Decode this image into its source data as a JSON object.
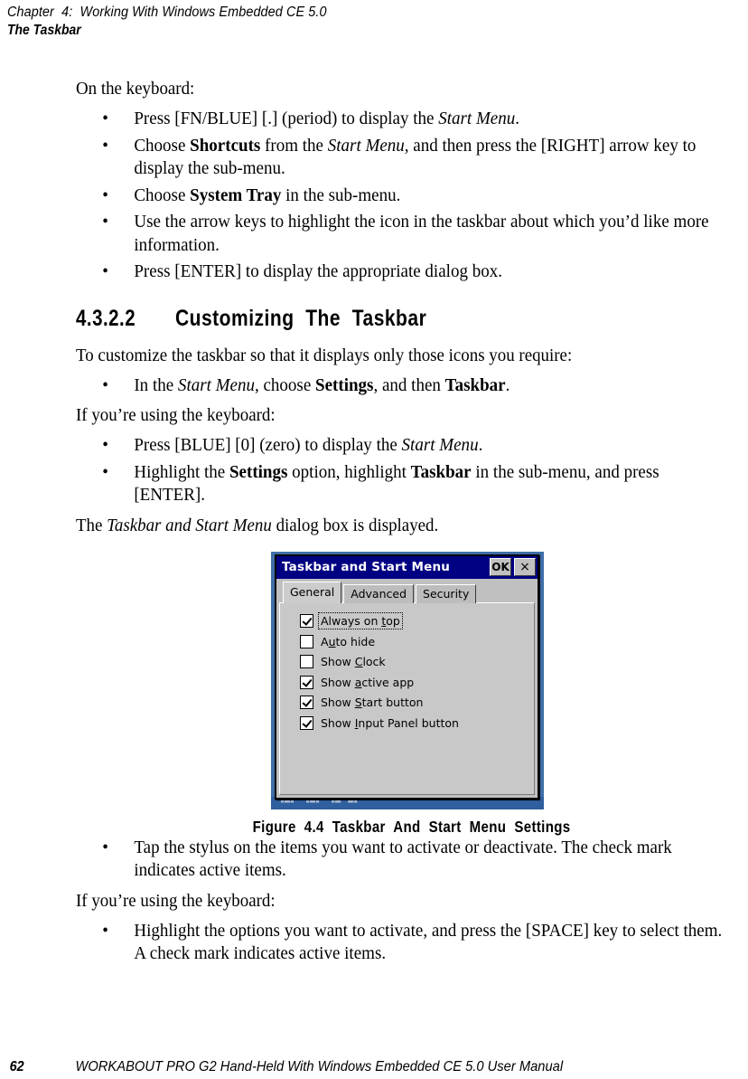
{
  "running_head": {
    "chapter": "Chapter  4:  Working With Windows Embedded CE 5.0",
    "section": "The Taskbar"
  },
  "content": {
    "intro_keyboard": "On the keyboard:",
    "bullets_1": [
      {
        "parts": [
          {
            "text": "Press [FN/BLUE] [.] (period) to display the ",
            "style": "normal"
          },
          {
            "text": "Start Menu",
            "style": "italic"
          },
          {
            "text": ".",
            "style": "normal"
          }
        ]
      },
      {
        "parts": [
          {
            "text": "Choose ",
            "style": "normal"
          },
          {
            "text": "Shortcuts",
            "style": "bold"
          },
          {
            "text": " from the ",
            "style": "normal"
          },
          {
            "text": "Start Menu",
            "style": "italic"
          },
          {
            "text": ", and then press the [RIGHT] arrow key to display the sub-menu.",
            "style": "normal"
          }
        ]
      },
      {
        "parts": [
          {
            "text": "Choose ",
            "style": "normal"
          },
          {
            "text": "System Tray",
            "style": "bold"
          },
          {
            "text": " in the sub-menu.",
            "style": "normal"
          }
        ]
      },
      {
        "parts": [
          {
            "text": "Use the arrow keys to highlight the icon in the taskbar about which you’d like more information.",
            "style": "normal"
          }
        ]
      },
      {
        "parts": [
          {
            "text": "Press [ENTER] to display the appropriate dialog box.",
            "style": "normal"
          }
        ]
      }
    ],
    "heading": {
      "number": "4.3.2.2",
      "title": "Customizing  The  Taskbar"
    },
    "para_customize": "To customize the taskbar so that it displays only those icons you require:",
    "bullets_2": [
      {
        "parts": [
          {
            "text": "In the ",
            "style": "normal"
          },
          {
            "text": "Start Menu",
            "style": "italic"
          },
          {
            "text": ", choose ",
            "style": "normal"
          },
          {
            "text": "Settings",
            "style": "bold"
          },
          {
            "text": ", and then ",
            "style": "normal"
          },
          {
            "text": "Taskbar",
            "style": "bold"
          },
          {
            "text": ".",
            "style": "normal"
          }
        ]
      }
    ],
    "para_keyboard_1": "If you’re using the keyboard:",
    "bullets_3": [
      {
        "parts": [
          {
            "text": "Press [BLUE] [0] (zero) to display the ",
            "style": "normal"
          },
          {
            "text": "Start Menu",
            "style": "italic"
          },
          {
            "text": ".",
            "style": "normal"
          }
        ]
      },
      {
        "parts": [
          {
            "text": "Highlight the ",
            "style": "normal"
          },
          {
            "text": "Settings",
            "style": "bold"
          },
          {
            "text": " option, highlight ",
            "style": "normal"
          },
          {
            "text": "Taskbar",
            "style": "bold"
          },
          {
            "text": " in the sub-menu, and press [ENTER].",
            "style": "normal"
          }
        ]
      }
    ],
    "para_dialog_displayed": {
      "parts": [
        {
          "text": "The ",
          "style": "normal"
        },
        {
          "text": "Taskbar and Start Menu",
          "style": "italic"
        },
        {
          "text": " dialog box is displayed.",
          "style": "normal"
        }
      ]
    },
    "bullets_4": [
      {
        "parts": [
          {
            "text": "Tap the stylus on the items you want to activate or deactivate. The check mark indicates active items.",
            "style": "normal"
          }
        ]
      }
    ],
    "para_keyboard_2": "If you’re using the keyboard:",
    "bullets_5": [
      {
        "parts": [
          {
            "text": "Highlight the options you want to activate, and press the [SPACE] key to select them. A check mark indicates active items.",
            "style": "normal"
          }
        ]
      }
    ],
    "figure_caption": "Figure  4.4  Taskbar  And  Start  Menu  Settings"
  },
  "dialog": {
    "title": "Taskbar and Start Menu",
    "ok_label": "OK",
    "close_label": "×",
    "tabs": [
      {
        "label": "General",
        "active": true
      },
      {
        "label": "Advanced",
        "active": false
      },
      {
        "label": "Security",
        "active": false
      }
    ],
    "options": [
      {
        "pre": "Always on ",
        "accel": "t",
        "post": "op",
        "checked": true,
        "focused": true
      },
      {
        "pre": "A",
        "accel": "u",
        "post": "to hide",
        "checked": false,
        "focused": false
      },
      {
        "pre": "Show ",
        "accel": "C",
        "post": "lock",
        "checked": false,
        "focused": false
      },
      {
        "pre": "Show ",
        "accel": "a",
        "post": "ctive app",
        "checked": true,
        "focused": false
      },
      {
        "pre": "Show ",
        "accel": "S",
        "post": "tart button",
        "checked": true,
        "focused": false
      },
      {
        "pre": "Show ",
        "accel": "I",
        "post": "nput Panel button",
        "checked": true,
        "focused": false
      }
    ],
    "taskbar_glyphs": "▐█▌ ▐█▌ ▐█─█▌",
    "colors": {
      "titlebar": "#000082",
      "dialog_face": "#c0c0c0",
      "desktop": "#3f6fa8",
      "taskbar": "#2f5f9e"
    }
  },
  "footer": {
    "page_number": "62",
    "manual_title": "WORKABOUT PRO G2 Hand-Held With Windows Embedded CE 5.0 User Manual"
  }
}
